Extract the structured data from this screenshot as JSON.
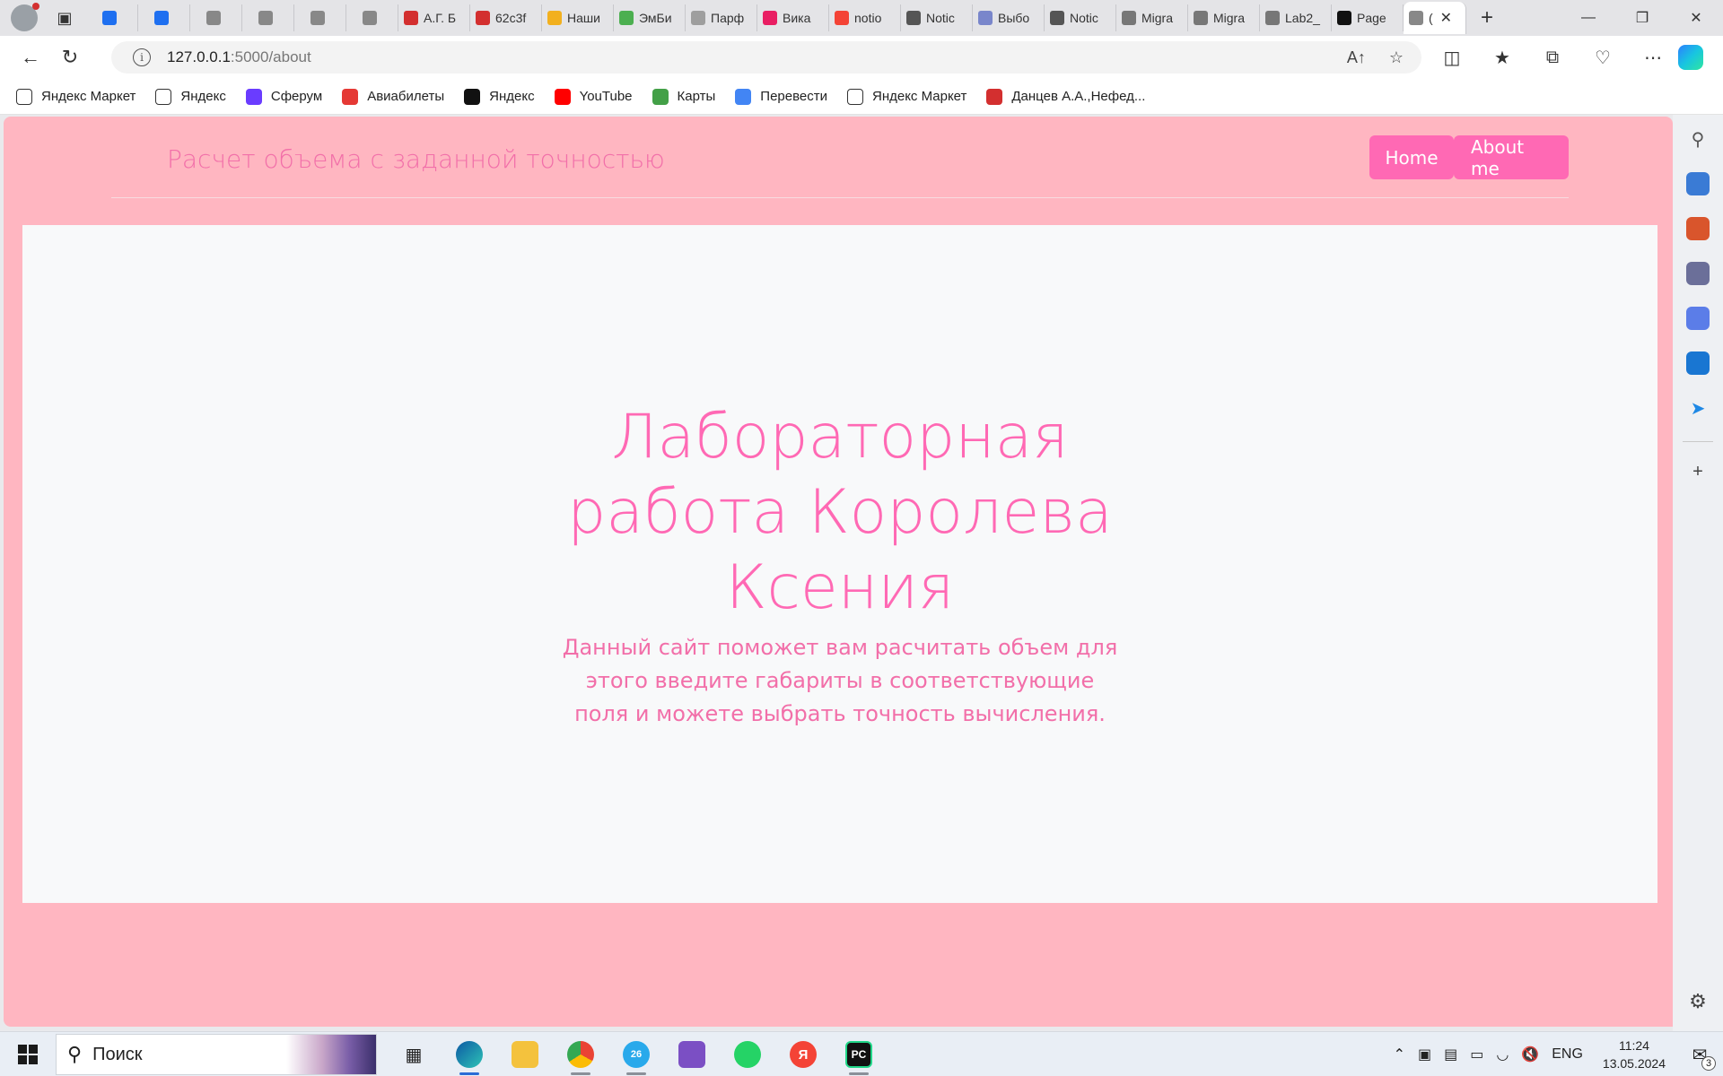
{
  "browser": {
    "tabs": [
      {
        "label": "",
        "icon": "mail-icon",
        "color": "#1e6ff0",
        "pinned": true
      },
      {
        "label": "",
        "icon": "moon-icon",
        "color": "#1e6ff0",
        "pinned": true
      },
      {
        "label": "",
        "icon": "page-icon",
        "color": "#888888",
        "pinned": true
      },
      {
        "label": "",
        "icon": "page-icon",
        "color": "#888888",
        "pinned": true
      },
      {
        "label": "",
        "icon": "page-icon",
        "color": "#888888",
        "pinned": true
      },
      {
        "label": "",
        "icon": "page-icon",
        "color": "#888888",
        "pinned": true
      },
      {
        "label": "А.Г. Б",
        "icon": "pdf-icon",
        "color": "#d32f2f"
      },
      {
        "label": "62c3f",
        "icon": "pdf-icon",
        "color": "#d32f2f"
      },
      {
        "label": "Наши",
        "icon": "trophy-icon",
        "color": "#f2b01e"
      },
      {
        "label": "ЭмБи",
        "icon": "site-icon",
        "color": "#4caf50"
      },
      {
        "label": "Парф",
        "icon": "site-icon",
        "color": "#9e9e9e"
      },
      {
        "label": "Вика",
        "icon": "site-icon",
        "color": "#e91e63"
      },
      {
        "label": "notio",
        "icon": "yandex-icon",
        "color": "#f44336"
      },
      {
        "label": "Notic",
        "icon": "notion-icon",
        "color": "#555555"
      },
      {
        "label": "Выбо",
        "icon": "doc-icon",
        "color": "#7986cb"
      },
      {
        "label": "Notic",
        "icon": "notion-icon",
        "color": "#555555"
      },
      {
        "label": "Migra",
        "icon": "book-icon",
        "color": "#777777"
      },
      {
        "label": "Migra",
        "icon": "book-icon",
        "color": "#777777"
      },
      {
        "label": "Lab2_",
        "icon": "github-icon",
        "color": "#777777"
      },
      {
        "label": "Page",
        "icon": "github-icon",
        "color": "#111111"
      },
      {
        "label": "(",
        "icon": "page-icon",
        "color": "#888888",
        "active": true
      }
    ],
    "address": {
      "host": "127.0.0.1",
      "path": ":5000/about"
    },
    "bookmarks": [
      {
        "label": "Яндекс Маркет",
        "icon": "page-icon",
        "color": "#ffffff"
      },
      {
        "label": "Яндекс",
        "icon": "page-icon",
        "color": "#ffffff"
      },
      {
        "label": "Сферум",
        "icon": "sferum-icon",
        "color": "#6a3cff"
      },
      {
        "label": "Авиабилеты",
        "icon": "plane-icon",
        "color": "#e53935"
      },
      {
        "label": "Яндекс",
        "icon": "yandex-icon",
        "color": "#111111"
      },
      {
        "label": "YouTube",
        "icon": "youtube-icon",
        "color": "#ff0000"
      },
      {
        "label": "Карты",
        "icon": "map-icon",
        "color": "#43a047"
      },
      {
        "label": "Перевести",
        "icon": "translate-icon",
        "color": "#4285f4"
      },
      {
        "label": "Яндекс Маркет",
        "icon": "page-icon",
        "color": "#ffffff"
      },
      {
        "label": "Данцев А.А.,Нефед...",
        "icon": "pdf-icon",
        "color": "#d32f2f"
      }
    ]
  },
  "site": {
    "brand": "Расчет объема с заданной точностью",
    "nav": {
      "home": "Home",
      "about": "About me"
    },
    "hero": {
      "title": "Лабораторная работа Королева Ксения",
      "lead": "Данный сайт поможет вам расчитать объем для этого введите габариты в соответствующие поля и можете выбрать точность вычисления."
    },
    "colors": {
      "background": "#ffb6c1",
      "accent": "#ff69b4",
      "panel": "#f8f9fa"
    }
  },
  "taskbar": {
    "search_placeholder": "Поиск",
    "lang": "ENG",
    "time": "11:24",
    "date": "13.05.2024",
    "notifications": "3",
    "telegram_badge": "26"
  }
}
